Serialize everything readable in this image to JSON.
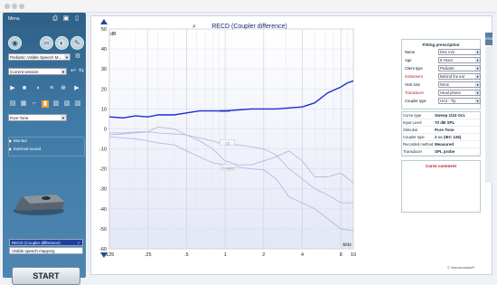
{
  "window": {
    "dots": 3
  },
  "sidebar": {
    "menu_label": "Menu",
    "header_icons": [
      "print-icon",
      "save-icon",
      "hearing-aid-icon"
    ],
    "selects": [
      {
        "value": "Pediatric Visible Speech M..."
      },
      {
        "value": "Current session"
      },
      {
        "value": "Pure Tone"
      }
    ],
    "checkboxes": [
      {
        "label": "Monitor"
      },
      {
        "label": "External sound"
      }
    ],
    "curves": [
      {
        "label": "RECD (Coupler difference)",
        "checked": "✓",
        "active": true
      },
      {
        "label": "Visible speech mapping",
        "checked": "",
        "active": false
      }
    ],
    "start_label": "START"
  },
  "chart_data": {
    "type": "line",
    "title": "RECD (Coupler difference)",
    "ylabel": "dB",
    "xlabel": "kHz",
    "x_scale": "log",
    "x_ticks": [
      ".125",
      ".25",
      ".5",
      "1",
      "2",
      "4",
      "8",
      "10"
    ],
    "x_tick_values": [
      0.125,
      0.25,
      0.5,
      1,
      2,
      4,
      8,
      10
    ],
    "y_ticks": [
      "50",
      "40",
      "30",
      "20",
      "10",
      "0",
      "-10",
      "-20",
      "-30",
      "-40",
      "-50",
      "-60"
    ],
    "ylim": [
      -60,
      50
    ],
    "series": [
      {
        "name": "RECD",
        "color": "#1d2fd1",
        "x": [
          0.125,
          0.16,
          0.2,
          0.25,
          0.3,
          0.4,
          0.5,
          0.63,
          0.8,
          1,
          1.25,
          1.6,
          2,
          2.5,
          3.15,
          4,
          5,
          6.3,
          8,
          9,
          10
        ],
        "y": [
          6,
          5.5,
          6.5,
          6,
          7,
          7,
          8,
          9,
          9,
          9,
          9.5,
          10,
          10,
          10,
          10.5,
          11,
          13,
          18,
          21,
          23,
          24
        ]
      },
      {
        "name": "",
        "color": "#b8b8e6",
        "x": [
          0.125,
          0.16,
          0.2,
          0.25,
          0.3,
          0.4,
          0.5,
          0.63,
          0.8,
          1,
          1.25,
          1.6,
          2,
          2.5,
          3.15,
          4,
          5,
          6.3,
          8,
          10
        ],
        "y": [
          -2,
          -2,
          -1.5,
          -1.5,
          -2,
          -2.5,
          -3,
          -4.5,
          -6,
          -8,
          -8,
          -9,
          -10,
          -13,
          -20,
          -25,
          -30,
          -33,
          -37,
          -37
        ]
      },
      {
        "name": "",
        "color": "#b8b8e6",
        "x": [
          0.125,
          0.16,
          0.2,
          0.25,
          0.3,
          0.4,
          0.5,
          0.63,
          0.8,
          1,
          1.25,
          1.6,
          2,
          2.5,
          3.15,
          4,
          5,
          6.3,
          8,
          10
        ],
        "y": [
          -3,
          -2.5,
          -2,
          -1.5,
          1,
          0,
          -3,
          -6,
          -10,
          -16,
          -18,
          -18,
          -16,
          -14,
          -11,
          -16,
          -24,
          -24,
          -22,
          -27
        ]
      },
      {
        "name": "",
        "color": "#b8b8e6",
        "x": [
          0.125,
          0.16,
          0.2,
          0.25,
          0.3,
          0.4,
          0.5,
          0.63,
          0.8,
          1,
          1.25,
          1.6,
          2,
          2.5,
          3.15,
          4,
          5,
          6.3,
          8,
          10
        ],
        "y": [
          -4,
          -4.5,
          -5,
          -6,
          -7,
          -8,
          -11,
          -14,
          -17,
          -18,
          -19,
          -20,
          -20.5,
          -25,
          -34,
          -37,
          -40,
          -45,
          -50,
          -51
        ]
      }
    ],
    "curve_labels": [
      {
        "text": "RECD"
      },
      {
        "text": "Cp"
      },
      {
        "text": "Coupler"
      }
    ]
  },
  "fitting": {
    "title": "Fitting prescription",
    "rows": [
      {
        "label": "Name",
        "value": "DSL m/o",
        "red": false
      },
      {
        "label": "Age",
        "value": "5 Years",
        "red": false
      },
      {
        "label": "Client type",
        "value": "Pediatric",
        "red": false
      },
      {
        "label": "Instrument",
        "value": "Behind the ear",
        "red": true
      },
      {
        "label": "Vent size",
        "value": "None",
        "red": false
      },
      {
        "label": "Transducer",
        "value": "Head phone",
        "red": true
      },
      {
        "label": "Coupler type",
        "value": "HA2 - Tip",
        "red": false
      }
    ]
  },
  "info": [
    {
      "k": "Curve type",
      "v": "Sweep 1/24 Oct."
    },
    {
      "k": "Input Level",
      "v": "70 dB SPL"
    },
    {
      "k": "Stimulus",
      "v": "Pure Tone"
    },
    {
      "k": "Coupler type",
      "v": "2 cc (IEC 126)"
    },
    {
      "k": "Recorded method",
      "v": "Measured"
    },
    {
      "k": "Transducer",
      "v": "SPL probe"
    }
  ],
  "curve_comment": "Curve comment",
  "copyright": "© Interacoustics®",
  "side_tab": "REM"
}
